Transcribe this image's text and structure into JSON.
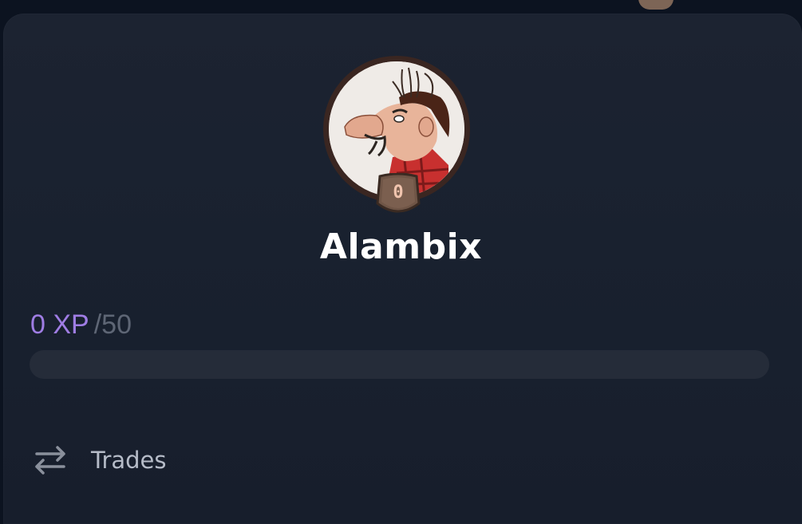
{
  "profile": {
    "username": "Alambix",
    "level": "0",
    "avatar_icon": "caricature-avatar"
  },
  "xp": {
    "current": "0 XP",
    "max": "/50",
    "progress_fraction": 0
  },
  "menu": {
    "trades": {
      "label": "Trades",
      "icon": "swap-arrows-icon"
    }
  },
  "colors": {
    "xp_accent": "#9f7de4",
    "card_bg": "#1a2230",
    "badge_bronze": "#7a5e4e"
  }
}
